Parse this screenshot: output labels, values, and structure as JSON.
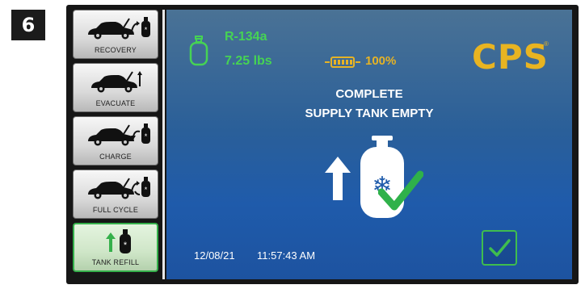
{
  "step_number": "6",
  "sidebar": {
    "items": [
      {
        "label": "RECOVERY",
        "icon": "car-to-tank-icon",
        "active": false
      },
      {
        "label": "EVACUATE",
        "icon": "car-evacuate-icon",
        "active": false
      },
      {
        "label": "CHARGE",
        "icon": "tank-to-car-icon",
        "active": false
      },
      {
        "label": "FULL CYCLE",
        "icon": "car-full-cycle-icon",
        "active": false
      },
      {
        "label": "TANK REFILL",
        "icon": "tank-refill-icon",
        "active": true
      }
    ]
  },
  "header": {
    "refrigerant": "R-134a",
    "weight": "7.25 lbs",
    "battery_percent": "100%",
    "brand": "CPS",
    "brand_mark": "®"
  },
  "status": {
    "line1": "COMPLETE",
    "line2": "SUPPLY TANK EMPTY"
  },
  "footer": {
    "date": "12/08/21",
    "time": "11:57:43 AM"
  },
  "colors": {
    "accent_green": "#46d354",
    "battery_yellow": "#e6b325",
    "brand_gold": "#e8b421",
    "screen_blue": "#1f5bab"
  }
}
